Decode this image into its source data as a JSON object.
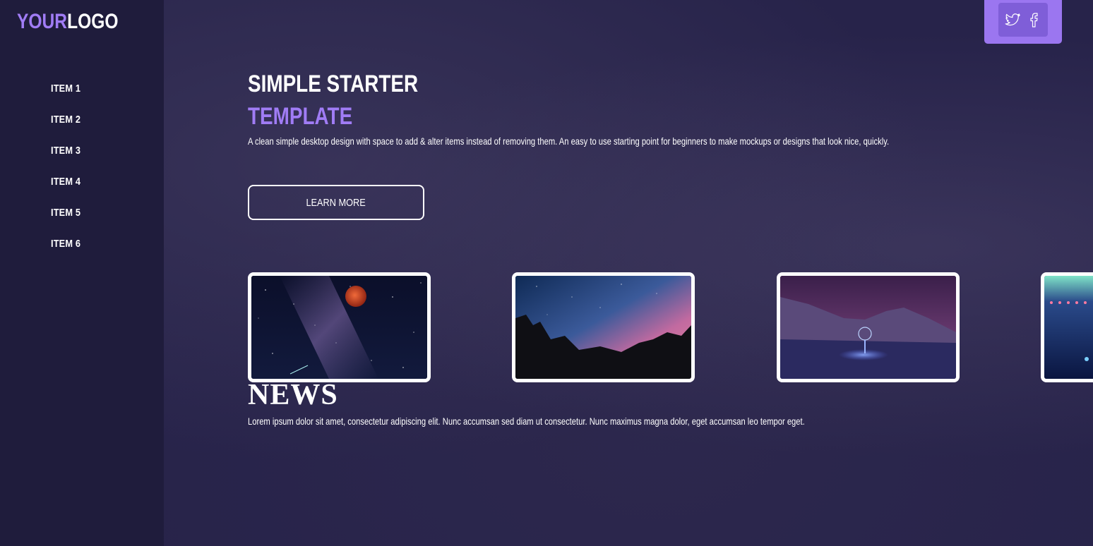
{
  "logo": {
    "accent": "YOUR",
    "plain": "LOGO"
  },
  "nav": {
    "items": [
      "ITEM 1",
      "ITEM 2",
      "ITEM 3",
      "ITEM 4",
      "ITEM 5",
      "ITEM 6"
    ]
  },
  "social": {
    "icons": [
      "twitter-icon",
      "facebook-icon"
    ]
  },
  "hero": {
    "title_line1": "SIMPLE STARTER",
    "title_line2": "TEMPLATE",
    "description": "A clean simple desktop design with space to add & alter items instead of removing them. An easy to use starting point for beginners to make mockups or designs that look nice, quickly.",
    "button_label": "LEARN MORE"
  },
  "gallery": {
    "images": [
      "red-moon-milky-way-image",
      "pink-sky-rocks-image",
      "snowy-mountain-light-painting-image",
      "neon-lights-image"
    ]
  },
  "news": {
    "title": "NEWS",
    "text": "Lorem ipsum dolor sit amet, consectetur adipiscing elit. Nunc accumsan sed diam ut consectetur. Nunc maximus magna dolor, eget accumsan leo tempor eget."
  },
  "colors": {
    "accent": "#a07cf5",
    "background": "#27234a",
    "sidebar": "#1f1c3c",
    "social_box": "#9b76f0"
  }
}
